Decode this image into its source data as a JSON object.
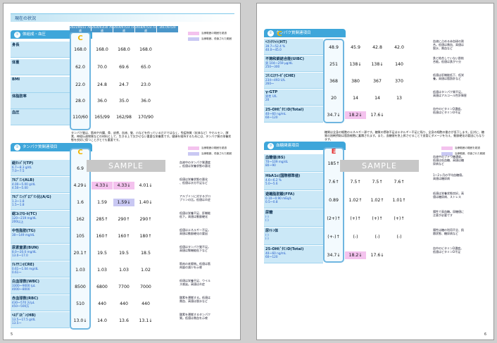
{
  "header": {
    "title": "現在の状況"
  },
  "page5": {
    "section1": {
      "title": "体組成・血圧",
      "grade": "C",
      "dates": [
        "2021/06/11 78歳",
        "2020/03/30 76歳",
        "2019/07/23 72歳",
        "2018/07/23 72歳",
        "2017/07/20"
      ],
      "rows": [
        {
          "name": "身長",
          "values": [
            "168.0",
            "168.0",
            "168.0",
            "168.0"
          ]
        },
        {
          "name": "体重",
          "values": [
            "62.0",
            "70.0",
            "69.6",
            "65.0"
          ]
        },
        {
          "name": "BMI",
          "values": [
            "22.0",
            "24.8",
            "24.7",
            "23.0"
          ]
        },
        {
          "name": "体脂肪率",
          "values": [
            "28.0",
            "36.0",
            "35.0",
            "36.0"
          ]
        },
        {
          "name": "血圧",
          "values": [
            "110/60",
            "165/99",
            "162/98",
            "170/90"
          ]
        }
      ]
    },
    "legend": {
      "pink": "治療範囲の範囲を超過",
      "blue": "治療範囲、低値された範囲"
    },
    "section2": {
      "title": "タンパク質関連項目",
      "intro": "タンパク質は、筋肉や内臓、骨、皮膚、血液、髪、爪などを作っているだけではなく、免疫物質（抗体など）やホルモン、酵素、神経伝達物質などの材料として、生きる上で欠かせない重要な栄養素です。健康を維持するためには、タンパク質の栄養状態を良好に保つことがとても重要です。",
      "grade": "C",
      "rows": [
        {
          "name": "総ﾀﾝﾊﾟｸ(TP)",
          "range1": "6.7〜8.3 g/dL",
          "range2": "7.0〜7.5",
          "values": [
            "6.9",
            "-",
            "-",
            "-"
          ],
          "hl": [
            "",
            "",
            "",
            ""
          ],
          "comment": "血液中のタンパク質濃度\n。低値は栄養状態の悪化"
        },
        {
          "name": "ｱﾙﾌﾞﾐﾝ(ALB)",
          "range1": "4.00〜5.00 g/dL",
          "range2": "4.50〜5.00",
          "values": [
            "4.29↓",
            "4.33↓",
            "4.33↓",
            "4.01↓"
          ],
          "hl": [
            "",
            "pink",
            "pink",
            ""
          ],
          "comment": "低値は栄養状態の悪化\n、低値は水分不足など"
        },
        {
          "name": "ｱﾙﾌﾞﾐﾝ/ｸﾞﾛﾌﾞﾘﾝ比(A/G)",
          "range1": "1.3〜1.8",
          "range2": "1.5〜1.8",
          "values": [
            "1.6",
            "1.59",
            "1.59↓",
            "1.40↓"
          ],
          "hl": [
            "",
            "",
            "blue",
            ""
          ],
          "comment": "アルブミンに対するグロ\nブリンの比。低値は炎症"
        },
        {
          "name": "総ｺﾚｽﾃﾛｰﾙ(TC)",
          "range1": "120〜219 mg/dL",
          "range2": "200以上",
          "values": [
            "162",
            "285↑",
            "290↑",
            "290↑"
          ],
          "hl": [
            "",
            "",
            "",
            ""
          ],
          "comment": "低値は栄養不足、肝機能\n低下。高値は動脈硬化"
        },
        {
          "name": "中性脂肪(TG)",
          "range1": "30〜149 mg/dL",
          "range2": "",
          "values": [
            "105",
            "160↑",
            "160↑",
            "180↑"
          ],
          "hl": [
            "",
            "",
            "",
            ""
          ],
          "comment": "低値はエネルギー不足。\n高値は動脈硬化の要因"
        },
        {
          "name": "尿素窒素(BUN)",
          "range1": "8.0〜20.0 mg/dL",
          "range2": "13.0〜17.0",
          "values": [
            "20.1↑",
            "19.5",
            "19.5",
            "18.5"
          ],
          "hl": [
            "",
            "",
            "",
            ""
          ],
          "comment": "低値はタンパク質不足。\n高値は腎機能低下など"
        },
        {
          "name": "ｸﾚｱﾁﾆﾝ(CRE)",
          "range1": "0.61〜1.04 mg/dL",
          "range2": "0.61〜",
          "values": [
            "1.03",
            "1.03",
            "1.03",
            "1.02"
          ],
          "hl": [
            "",
            "",
            "",
            ""
          ],
          "comment": "筋肉の老廃物。低値は筋\n肉量の減少を示唆"
        },
        {
          "name": "白血球数(WBC)",
          "range1": "3300〜9000 /μL",
          "range2": "4000〜8000",
          "values": [
            "8500",
            "6800",
            "7700",
            "7000"
          ],
          "hl": [
            "",
            "",
            "",
            ""
          ],
          "comment": "低値は栄養不足、ウイル\nス感染。高値は炎症"
        },
        {
          "name": "赤血球数(RBC)",
          "range1": "430〜570 万/μL",
          "range2": "450〜500万",
          "values": [
            "510",
            "440",
            "440",
            "440"
          ],
          "hl": [
            "",
            "",
            "",
            ""
          ],
          "comment": "酸素を運搬する。低値は\n貧血、高値は脱水など"
        },
        {
          "name": "ﾍﾓｸﾞﾛﾋﾞﾝ(HB)",
          "range1": "13.5〜17.5 g/dL",
          "range2": "13.5〜",
          "values": [
            "13.0↓",
            "14.0",
            "13.6",
            "13.1↓"
          ],
          "hl": [
            "",
            "",
            "",
            ""
          ],
          "comment": "酸素を運搬するタンパク\n質。低値は貧血を示唆"
        }
      ]
    },
    "sample": "SAMPLE",
    "page_number": "5"
  },
  "page6": {
    "section2": {
      "title": "タンパク質関連項目",
      "grade": "C",
      "rows": [
        {
          "name": "ﾍﾏﾄｸﾘｯﾄ(HT)",
          "range1": "39.7〜52.4 %",
          "range2": "40.0〜45.0",
          "values": [
            "48.9",
            "45.9",
            "42.8",
            "42.0"
          ],
          "hl": [
            "",
            "",
            "",
            ""
          ],
          "comment": "血液に占める赤血球の割\n合。低値は貧血、高値は\n脱水、貧血など"
        },
        {
          "name": "不飽和鉄結合能(UIBC)",
          "range1": "男 104〜259 μg/dL",
          "range2": "250〜300",
          "values": [
            "251",
            "138↓",
            "138↓",
            "140"
          ],
          "hl": [
            "",
            "",
            "",
            ""
          ],
          "comment": "鉄と結合していない鉄結\n合能。低値は鉄が十分"
        },
        {
          "name": "ｺﾘﾝｴｽﾃﾗｰｾﾞ(CHE)",
          "range1": "234〜493 U/L",
          "range2": "260〜",
          "values": [
            "368",
            "380",
            "367",
            "370"
          ],
          "hl": [
            "",
            "",
            "",
            ""
          ],
          "comment": "低値は肝機能低下、低栄\n養。高値は脂肪肝など"
        },
        {
          "name": "γ-GTP",
          "range1": "男性 U/L",
          "range2": "20",
          "values": [
            "20",
            "14",
            "14",
            "13"
          ],
          "hl": [
            "",
            "",
            "",
            ""
          ],
          "comment": "低値はタンパク質不足。\n高値はアルコール性肝障害"
        },
        {
          "name": "25-OHﾋﾞﾀﾐﾝD(Total)",
          "range1": "40〜60 ng/mL",
          "range2": "60〜120",
          "values": [
            "34.7↓",
            "18.2↓",
            "17.6↓",
            ""
          ],
          "hl": [
            "",
            "pink",
            "",
            ""
          ],
          "comment": "血中のビタミンD濃度。\n低値はビタミンD不足"
        }
      ]
    },
    "section3": {
      "title": "血糖関連項目",
      "intro": "糖質は全身の細胞のエネルギー源です。糖質の摂取不足はエネルギー不足に陥り、全身の細胞の働きが低下します。反対に、糖質の過剰摂取は脂肪細胞に蓄積されます。また、血糖値を急上昇させることで血管にダメージを与え、動脈硬化の要因にもなります。",
      "grade": "E",
      "rows": [
        {
          "name": "血糖値(BS)",
          "range1": "70〜109 mg/dL",
          "range2": "80〜90",
          "values": [
            "185↑",
            "-",
            "-",
            "-"
          ],
          "hl": [
            "",
            "",
            "",
            ""
          ],
          "comment": "血液中のブドウ糖濃度。\n低値は低血糖、高値は糖\n尿病など"
        },
        {
          "name": "HbA1c(国際標準値)",
          "range1": "4.6〜6.2 %",
          "range2": "5.0〜5.6",
          "values": [
            "7.6↑",
            "7.5↑",
            "7.5↑",
            "7.6↑"
          ],
          "hl": [
            "",
            "",
            "",
            ""
          ],
          "comment": "1〜2ヶ月の平均血糖値。\n高値は糖尿病"
        },
        {
          "name": "遊離脂肪酸(FFA)",
          "range1": "0.10〜0.90 mEq/L",
          "range2": "0.5〜0.8",
          "values": [
            "0.89",
            "1.02↑",
            "1.02↑",
            "1.01↑"
          ],
          "hl": [
            "",
            "",
            "",
            ""
          ],
          "comment": "低値は栄養状態良好。高\n値は糖尿病、ストレス"
        },
        {
          "name": "尿糖",
          "range1": "(-)",
          "range2": "(-)",
          "values": [
            "(2+)↑",
            "(+)↑",
            "(+)↑",
            "(+)↑"
          ],
          "hl": [
            "",
            "",
            "",
            ""
          ],
          "comment": "陽性で高血糖。尿糖値に\n注意が必要です"
        },
        {
          "name": "尿ｹﾄﾝ体",
          "range1": "(-)",
          "range2": "(-)",
          "values": [
            "(+-)↑",
            "(-)",
            "(-)",
            "(-)"
          ],
          "hl": [
            "",
            "",
            "",
            ""
          ],
          "comment": "陽性は糖の利用不全、飢\n餓状態、糖尿病など"
        },
        {
          "name": "25-OHﾋﾞﾀﾐﾝD(Total)",
          "range1": "40〜60 ng/mL",
          "range2": "60〜120",
          "values": [
            "34.7↓",
            "18.2↓",
            "17.6↓",
            ""
          ],
          "hl": [
            "",
            "pink",
            "",
            ""
          ],
          "comment": "血中のビタミンD濃度。\n低値はビタミンD不足"
        }
      ]
    },
    "sample": "SAMPLE",
    "page_number": "6"
  },
  "colors": {
    "accent": "#3ea6da",
    "label_bg": "#cbe8f7",
    "pink": "#f4c2ee",
    "blue": "#c9c8f3",
    "grade_c": "#f0b400",
    "grade_e": "#e53030"
  }
}
